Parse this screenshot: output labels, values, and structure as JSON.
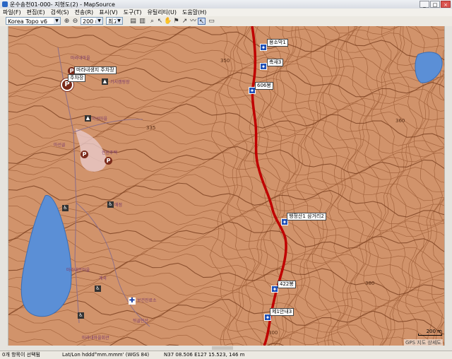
{
  "window": {
    "title": "운수송천01-000- 지형도(2) - MapSource"
  },
  "menu": [
    "파일(F)",
    "편집(E)",
    "검색(S)",
    "전송(R)",
    "표시(V)",
    "도구(T)",
    "유틸리티(U)",
    "도움말(H)"
  ],
  "toolbar": {
    "map_product": "Korea Topo v6",
    "zoom_level": "200 m",
    "detail": "최고"
  },
  "map": {
    "waypoints": [
      "용소막1",
      "촉새3",
      "606봉",
      "행정산1 삼거리2",
      "422봉",
      "제1안내3"
    ],
    "parking_label": "마라내생지 주차장",
    "parking_label2": "주차장",
    "elevations": [
      "350",
      "335",
      "300",
      "380",
      "360"
    ],
    "places": [
      "마라내마을",
      "가서캠핑장",
      "마선마을",
      "마선골",
      "전원주택",
      "매점",
      "보건진료소",
      "마라내마을회관",
      "뒤골안산",
      "마라내안마을",
      "계곡"
    ],
    "scale": "200 m",
    "gps_note": "GPS 지도 상세도"
  },
  "status": {
    "selection": "0개 항목이 선택됨",
    "coord_format": "Lat/Lon hddd°mm.mmm' (WGS 84)",
    "position": "N37 08.506 E127 15.523, 146 m"
  },
  "colors": {
    "route": "#c00000",
    "terrain": "#d1936b",
    "water": "#5b8fd6"
  }
}
